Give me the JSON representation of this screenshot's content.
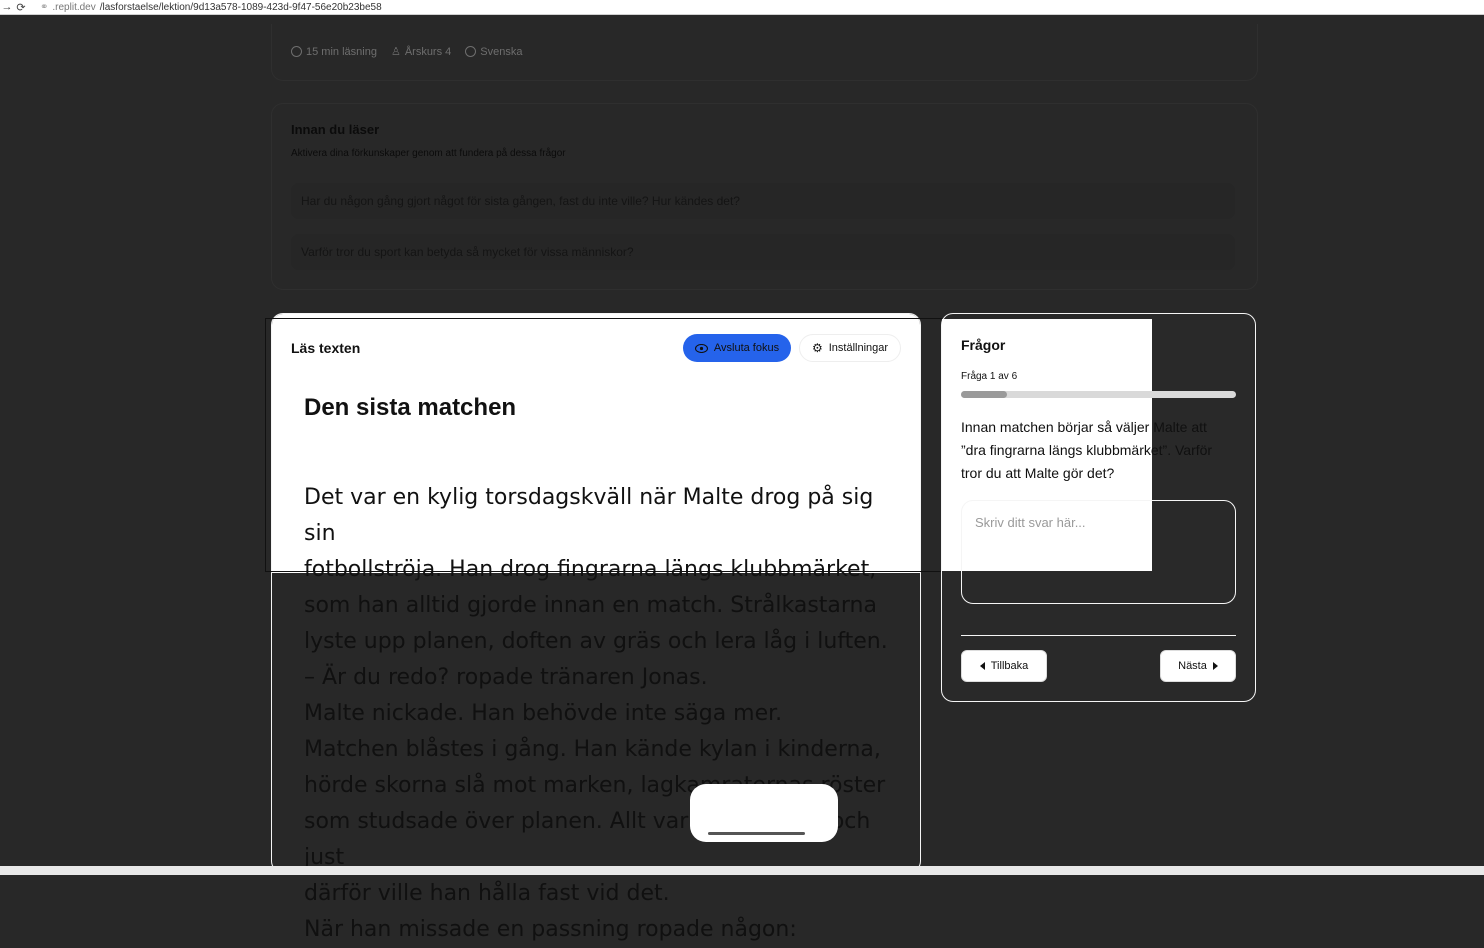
{
  "browser": {
    "url_host": ".replit.dev",
    "url_path": "/lasforstaelse/lektion/9d13a578-1089-423d-9f47-56e20b23be58"
  },
  "meta": {
    "reading_time": "15 min läsning",
    "grade": "Årskurs 4",
    "language": "Svenska"
  },
  "prereading": {
    "title": "Innan du läser",
    "subtitle": "Aktivera dina förkunskaper genom att fundera på dessa frågor",
    "questions": [
      "Har du någon gång gjort något för sista gången, fast du inte ville? Hur kändes det?",
      "Varför tror du sport kan betyda så mycket för vissa människor?"
    ]
  },
  "reader": {
    "title": "Läs texten",
    "exit_focus_label": "Avsluta fokus",
    "settings_label": "Inställningar",
    "story_title": "Den sista matchen",
    "lines": [
      "Det var en kylig torsdagskväll när Malte drog på sig sin",
      "fotbollströja. Han drog fingrarna längs klubbmärket,",
      "som han alltid gjorde innan en match. Strålkastarna",
      "lyste upp planen, doften av gräs och lera låg i luften.",
      "– Är du redo? ropade tränaren Jonas.",
      "Malte nickade. Han behövde inte säga mer.",
      "Matchen blåstes i gång. Han kände kylan i kinderna,",
      "hörde skorna slå mot marken, lagkamraternas röster",
      "som studsade över planen. Allt var som vanligt och just",
      "därför ville han hålla fast vid det.",
      "När han missade en passning ropade någon:"
    ]
  },
  "questions_panel": {
    "title": "Frågor",
    "counter": "Fråga 1 av 6",
    "progress": 0.1667,
    "question": "Innan matchen börjar så väljer Malte att ”dra fingrarna längs klubbmärket”. Varför tror du att Malte gör det?",
    "answer_placeholder": "Skriv ditt svar här...",
    "answer_value": "",
    "back_label": "Tillbaka",
    "next_label": "Nästa"
  }
}
